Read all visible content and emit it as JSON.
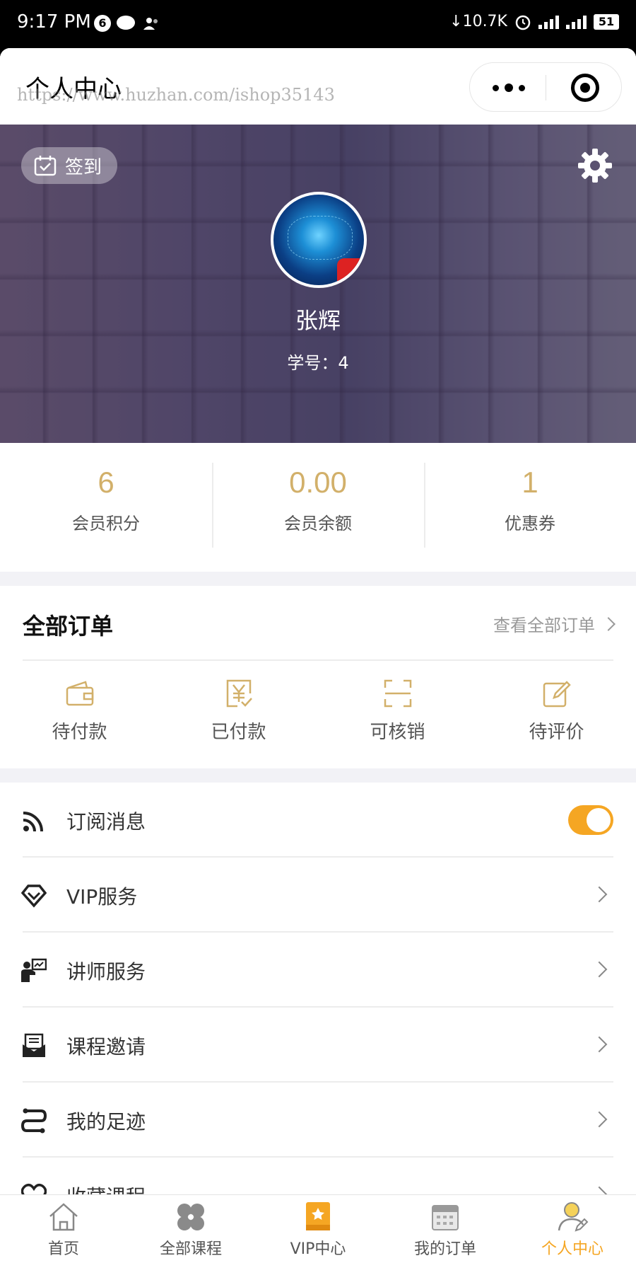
{
  "status_bar": {
    "time": "9:17 PM",
    "notification_count": "6",
    "net_speed": "↓10.7K",
    "battery": "51"
  },
  "header": {
    "title": "个人中心",
    "watermark": "https://www.huzhan.com/ishop35143"
  },
  "profile": {
    "signin_label": "签到",
    "name": "张辉",
    "student_id": "学号：4"
  },
  "stats": [
    {
      "value": "6",
      "label": "会员积分"
    },
    {
      "value": "0.00",
      "label": "会员余额"
    },
    {
      "value": "1",
      "label": "优惠券"
    }
  ],
  "orders": {
    "title": "全部订单",
    "view_all": "查看全部订单",
    "items": [
      {
        "label": "待付款",
        "icon": "wallet-icon"
      },
      {
        "label": "已付款",
        "icon": "paid-icon"
      },
      {
        "label": "可核销",
        "icon": "scan-icon"
      },
      {
        "label": "待评价",
        "icon": "edit-icon"
      }
    ]
  },
  "menu": [
    {
      "label": "订阅消息",
      "icon": "rss-icon",
      "toggle": true
    },
    {
      "label": "VIP服务",
      "icon": "diamond-icon"
    },
    {
      "label": "讲师服务",
      "icon": "teacher-icon"
    },
    {
      "label": "课程邀请",
      "icon": "invite-mail-icon"
    },
    {
      "label": "我的足迹",
      "icon": "footprint-icon"
    },
    {
      "label": "收藏课程",
      "icon": "heart-icon"
    }
  ],
  "tabs": [
    {
      "label": "首页",
      "icon": "home-icon"
    },
    {
      "label": "全部课程",
      "icon": "clover-icon"
    },
    {
      "label": "VIP中心",
      "icon": "vip-book-icon"
    },
    {
      "label": "我的订单",
      "icon": "calendar-icon"
    },
    {
      "label": "个人中心",
      "icon": "user-icon",
      "active": true
    }
  ],
  "colors": {
    "accent": "#f5a623",
    "gold": "#d2b06a"
  }
}
